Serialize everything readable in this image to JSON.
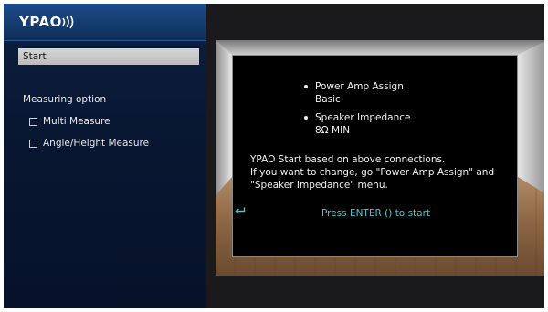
{
  "header": {
    "logo_text": "YPAO",
    "logo_icon": "sound-waves-icon"
  },
  "menu": {
    "start_label": "Start",
    "measuring_option_label": "Measuring option",
    "options": [
      {
        "label": "Multi Measure",
        "checked": false
      },
      {
        "label": "Angle/Height Measure",
        "checked": false
      }
    ]
  },
  "panel": {
    "items": [
      {
        "title": "Power Amp Assign",
        "value": "Basic"
      },
      {
        "title": "Speaker Impedance",
        "value": "8Ω MIN"
      }
    ],
    "message_lines": [
      "YPAO Start based on above connections.",
      "If you want to change, go \"Power Amp Assign\" and",
      "\"Speaker Impedance\" menu."
    ],
    "press_prefix": "Press ENTER",
    "press_icon": "enter-return-icon",
    "press_suffix": "to start"
  },
  "colors": {
    "accent_text": "#49c7d6",
    "left_panel": "#081732",
    "selected_item": "#c8c8c8"
  }
}
